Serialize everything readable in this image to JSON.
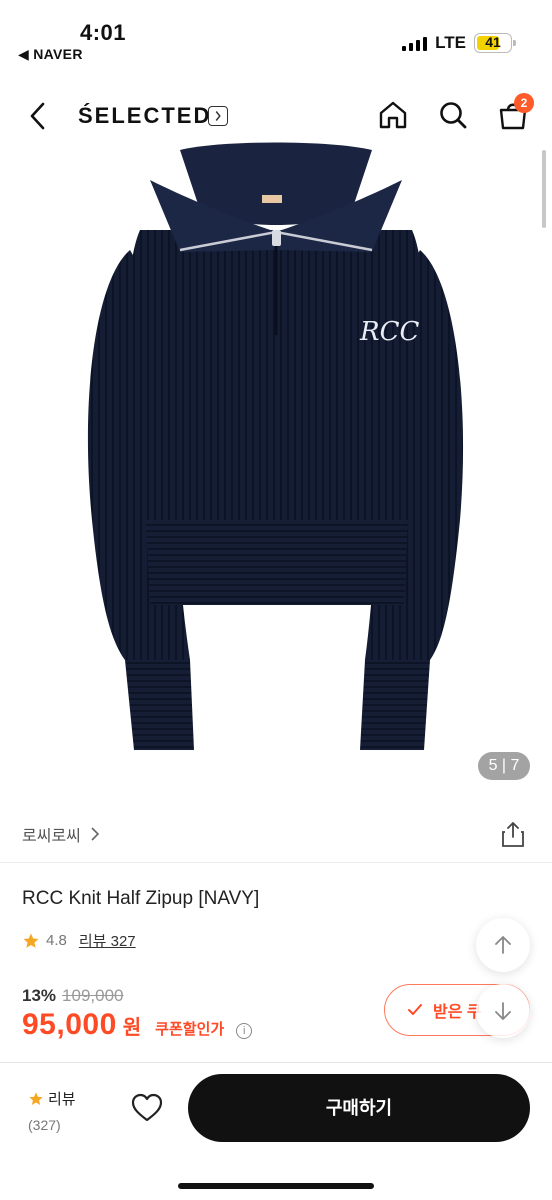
{
  "status_bar": {
    "time": "4:01",
    "back_app": "◀ NAVER",
    "network": "LTE",
    "battery": "41"
  },
  "nav": {
    "brand": "ŚELECTED",
    "cart_count": "2"
  },
  "gallery": {
    "counter": "5 | 7",
    "logo_text": "RCC"
  },
  "product": {
    "store": "로씨로씨",
    "title": "RCC Knit Half Zipup [NAVY]",
    "rating": "4.8",
    "reviews_label": "리뷰 327",
    "discount": "13%",
    "original_price": "109,000",
    "price": "95,000",
    "currency": "원",
    "coupon_label": "쿠폰할인가"
  },
  "coupon_button": {
    "label": "받은 쿠"
  },
  "bottom_bar": {
    "review_label": "리뷰",
    "review_count": "(327)",
    "buy_label": "구매하기"
  },
  "colors": {
    "accent": "#ff4a26",
    "badge": "#ff5a2a",
    "sweater": "#141d33",
    "star": "#f5a623",
    "battery": "#f2d200"
  }
}
